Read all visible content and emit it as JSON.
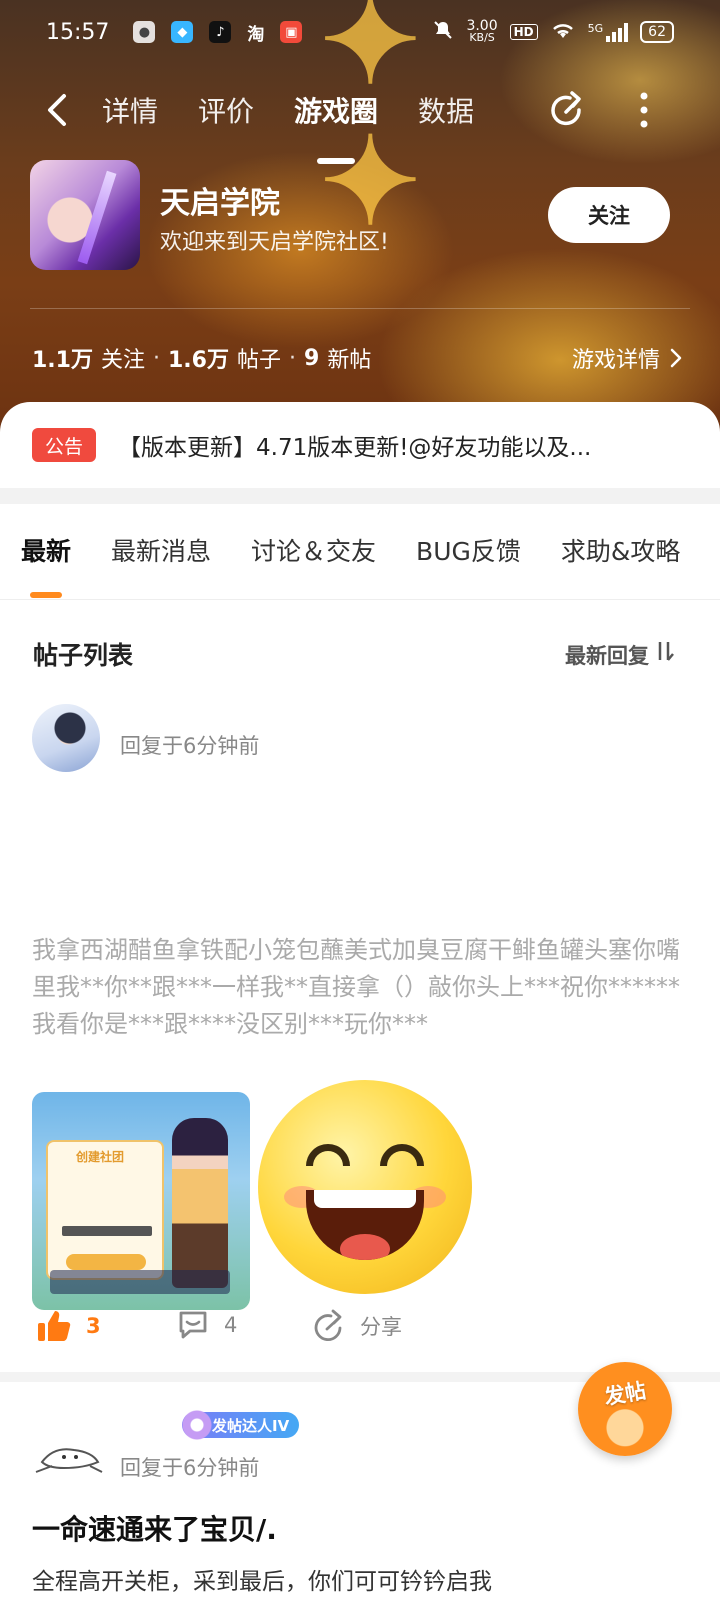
{
  "status_bar": {
    "time": "15:57",
    "app_icons": [
      "wechat-icon",
      "qq-icon",
      "tiktok-icon",
      "taobao-icon",
      "game-center-icon"
    ],
    "taobao_label": "淘",
    "net_speed_value": "3.00",
    "net_speed_unit": "KB/S",
    "hd_label": "HD",
    "network_label": "5G",
    "battery": "62"
  },
  "nav": {
    "tabs": [
      {
        "label": "详情"
      },
      {
        "label": "评价"
      },
      {
        "label": "游戏圈"
      },
      {
        "label": "数据"
      }
    ],
    "active_tab": "游戏圈"
  },
  "game": {
    "title": "天启学院",
    "subtitle": "欢迎来到天启学院社区!",
    "follow_label": "关注",
    "followers": "1.1万",
    "followers_label": "关注",
    "posts": "1.6万",
    "posts_label": "帖子",
    "new_posts": "9",
    "new_posts_label": "新帖",
    "detail_link": "游戏详情"
  },
  "announcement": {
    "badge": "公告",
    "text": "【版本更新】4.71版本更新!@好友功能以及..."
  },
  "categories": [
    {
      "label": "最新"
    },
    {
      "label": "最新消息"
    },
    {
      "label": "讨论＆交友"
    },
    {
      "label": "BUG反馈"
    },
    {
      "label": "求助&攻略"
    }
  ],
  "list": {
    "title": "帖子列表",
    "sort_label": "最新回复",
    "sort_icon": "sort-icon"
  },
  "posts": [
    {
      "reply_time": "回复于6分钟前",
      "body": "我拿西湖醋鱼拿铁配小笼包蘸美式加臭豆腐干鲱鱼罐头塞你嘴里我**你**跟***一样我**直接拿（）敲你头上***祝你******我看你是***跟****没区别***玩你***",
      "images": [
        "game-screenshot",
        "laughing-emoji"
      ],
      "image_text": {
        "panel_title": "创建社团"
      },
      "likes": "3",
      "comments": "4",
      "share_label": "分享"
    },
    {
      "badge": "发帖达人IV",
      "reply_time": "回复于6分钟前",
      "title": "一命速通来了宝贝/.",
      "excerpt": "全程高开关柜，采到最后，你们可可钤钤启我"
    }
  ],
  "fab": {
    "label": "发帖"
  },
  "colors": {
    "accent": "#ff8a1e",
    "announce_red": "#f04a3e",
    "like_orange": "#ff7a12",
    "text_gray": "#888888"
  }
}
